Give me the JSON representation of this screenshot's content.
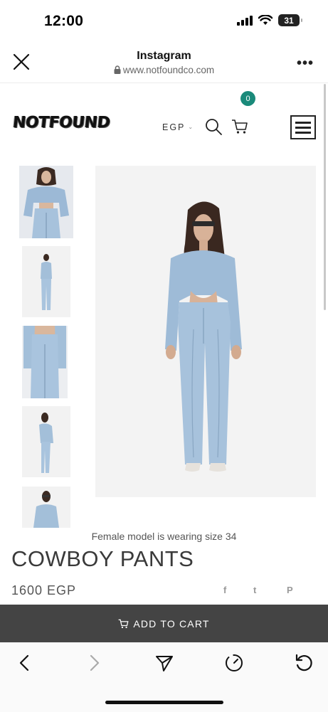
{
  "status_bar": {
    "time": "12:00",
    "battery": "31"
  },
  "browser": {
    "title": "Instagram",
    "url": "www.notfoundco.com"
  },
  "site": {
    "logo": "NOTFOUND",
    "currency": "EGP",
    "cart_count": "0"
  },
  "product": {
    "caption": "Female model is wearing size 34",
    "title": "COWBOY PANTS",
    "price": "1600 EGP",
    "add_to_cart": "ADD TO CART"
  },
  "share_icons": [
    "facebook-icon",
    "twitter-icon",
    "pinterest-icon"
  ],
  "share_glyphs": {
    "facebook": "f",
    "twitter": "t",
    "pinterest": "P"
  },
  "colors": {
    "accent": "#1a8a7a",
    "cart_bar": "#444444",
    "denim": "#a9c3dc"
  }
}
